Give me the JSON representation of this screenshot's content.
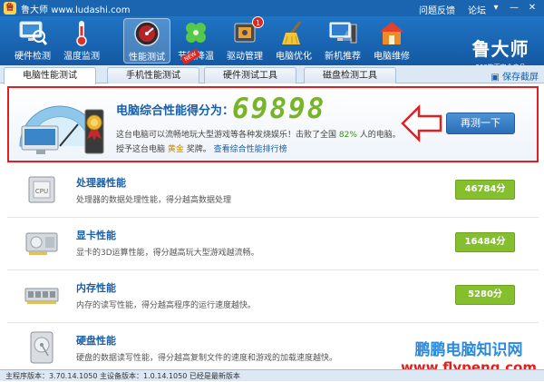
{
  "titlebar": {
    "app_name": "鲁大师",
    "url": "www.ludashi.com",
    "links": [
      "问题反馈",
      "论坛"
    ],
    "buttons": [
      "▾",
      "—",
      "✕"
    ]
  },
  "toolbar": {
    "items": [
      {
        "label": "硬件检测",
        "icon": "monitor-magnifier-icon",
        "color": "#9ad0f2"
      },
      {
        "label": "温度监测",
        "icon": "thermometer-icon",
        "color": "#f0f0f0"
      },
      {
        "label": "性能测试",
        "icon": "speedometer-icon",
        "color": "#c0282c",
        "active": true
      },
      {
        "label": "节能降温",
        "icon": "clover-icon",
        "color": "#56c84a"
      },
      {
        "label": "驱动管理",
        "icon": "chip-icon",
        "color": "#5a5a5a",
        "badge": "1"
      },
      {
        "label": "电脑优化",
        "icon": "broom-icon",
        "color": "#f2c53a"
      },
      {
        "label": "新机推荐",
        "icon": "new-pc-icon",
        "color": "#d6e7f6"
      },
      {
        "label": "电脑维修",
        "icon": "house-icon",
        "color": "#f08a24"
      }
    ],
    "new_badge": "NEW",
    "brand": {
      "name": "鲁大师",
      "sub": "360旗下安全产品"
    }
  },
  "tabs": [
    "电脑性能测试",
    "手机性能测试",
    "硬件测试工具",
    "磁盘检测工具"
  ],
  "save_shot": "保存截屏",
  "score": {
    "title": "电脑综合性能得分为：",
    "value": "69898",
    "desc_before": "这台电脑可以流畅地玩大型游戏等各种发烧娱乐！击败了全国",
    "percent": "82%",
    "desc_after": "人的电脑。",
    "medal_before": "授予这台电脑",
    "medal": "黄金",
    "medal_after": "奖牌。",
    "rank_link": "查看综合性能排行榜",
    "retest_label": "再测一下"
  },
  "components": [
    {
      "title": "处理器性能",
      "desc": "处理器的数据处理性能，得分越高数据处理",
      "score": "46784分",
      "icon": "cpu-icon"
    },
    {
      "title": "显卡性能",
      "desc": "显卡的3D运算性能，得分越高玩大型游戏越流畅。",
      "score": "16484分",
      "icon": "graphics-card-icon"
    },
    {
      "title": "内存性能",
      "desc": "内存的读写性能，得分越高程序的运行速度越快。",
      "score": "5280分",
      "icon": "memory-icon"
    },
    {
      "title": "硬盘性能",
      "desc": "硬盘的数据读写性能，得分越高复制文件的速度和游戏的加载速度越快。",
      "score": "",
      "icon": "hard-disk-icon"
    }
  ],
  "watermark": {
    "line1": "鹏鹏电脑知识网",
    "line2": "www.flypeng.com"
  },
  "statusbar": "主程序版本：3.70.14.1050   主设备版本：1.0.14.1050   已经是最新版本"
}
